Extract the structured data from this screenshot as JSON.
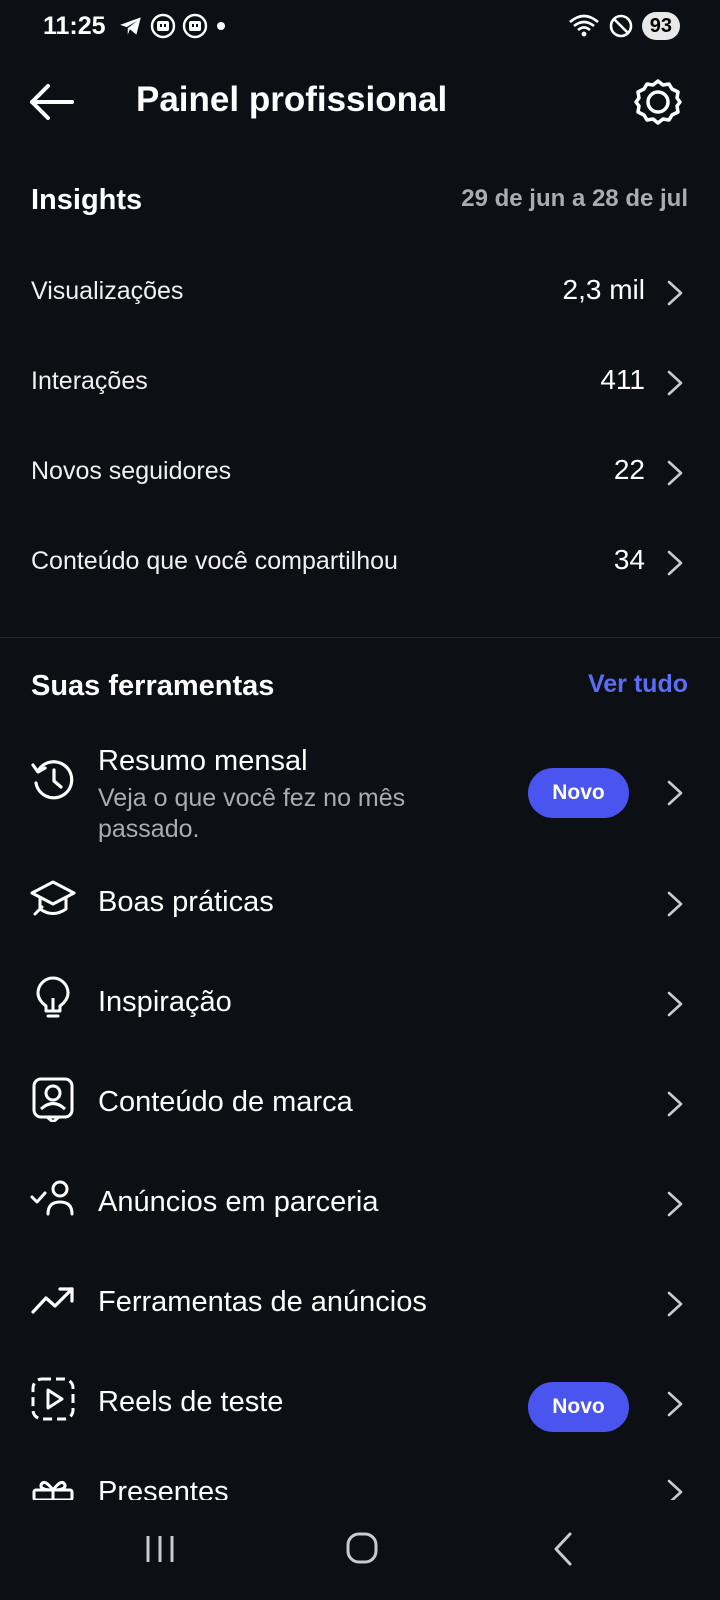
{
  "status_bar": {
    "time": "11:25",
    "battery": "93",
    "left_icons": [
      "telegram-icon",
      "notification-icon",
      "notification-icon",
      "dot-icon"
    ],
    "right_icons": [
      "wifi-icon",
      "do-not-disturb-icon"
    ]
  },
  "header": {
    "title": "Painel profissional",
    "back_icon": "arrow-left-icon",
    "settings_icon": "gear-icon"
  },
  "insights": {
    "title": "Insights",
    "date_range": "29 de jun a 28 de jul",
    "rows": [
      {
        "label": "Visualizações",
        "value": "2,3 mil"
      },
      {
        "label": "Interações",
        "value": "411"
      },
      {
        "label": "Novos seguidores",
        "value": "22"
      },
      {
        "label": "Conteúdo que você compartilhou",
        "value": "34"
      }
    ]
  },
  "tools": {
    "title": "Suas ferramentas",
    "see_all": "Ver tudo",
    "items": [
      {
        "icon": "history-clock-icon",
        "label": "Resumo mensal",
        "subtitle": "Veja o que você fez no mês passado.",
        "badge": "Novo"
      },
      {
        "icon": "graduation-cap-icon",
        "label": "Boas práticas"
      },
      {
        "icon": "lightbulb-icon",
        "label": "Inspiração"
      },
      {
        "icon": "branded-content-icon",
        "label": "Conteúdo de marca"
      },
      {
        "icon": "partnership-ads-icon",
        "label": "Anúncios em parceria"
      },
      {
        "icon": "trending-up-icon",
        "label": "Ferramentas de anúncios"
      },
      {
        "icon": "trial-reels-icon",
        "label": "Reels de teste",
        "badge": "Novo"
      },
      {
        "icon": "gift-icon",
        "label": "Presentes"
      }
    ]
  },
  "nav_bar": {
    "icons": [
      "recent-apps-icon",
      "home-icon",
      "back-icon"
    ]
  }
}
